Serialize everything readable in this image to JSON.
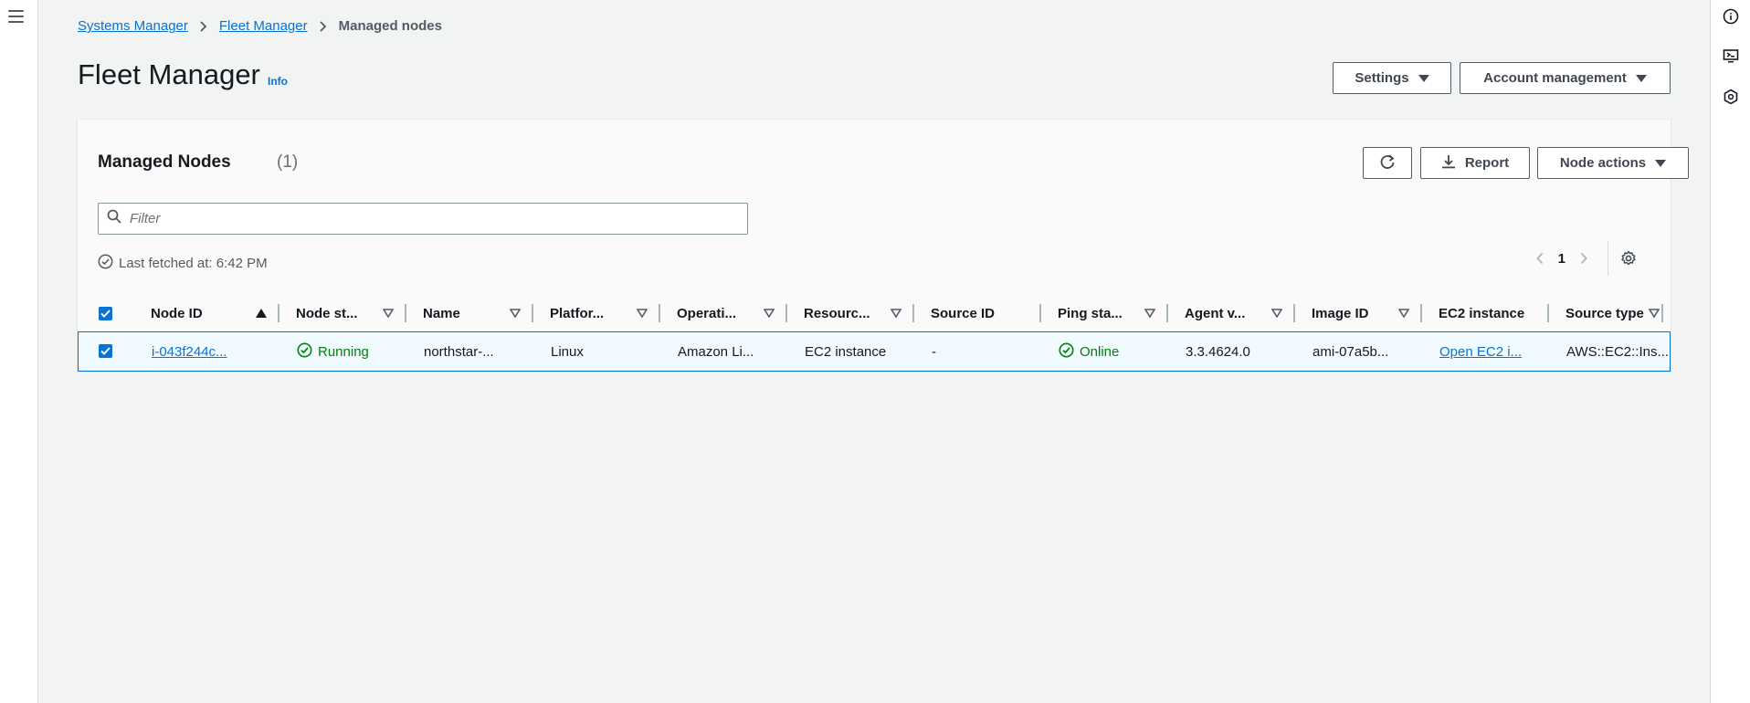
{
  "breadcrumb": {
    "items": [
      "Systems Manager",
      "Fleet Manager"
    ],
    "current": "Managed nodes"
  },
  "header": {
    "title": "Fleet Manager",
    "info": "Info",
    "settings_label": "Settings",
    "account_label": "Account management"
  },
  "panel": {
    "title": "Managed Nodes",
    "count": "(1)",
    "report_label": "Report",
    "node_actions_label": "Node actions",
    "filter_placeholder": "Filter",
    "last_fetched": "Last fetched at: 6:42 PM",
    "page": "1"
  },
  "table": {
    "columns": [
      "Node ID",
      "Node st...",
      "Name",
      "Platfor...",
      "Operati...",
      "Resourc...",
      "Source ID",
      "Ping sta...",
      "Agent v...",
      "Image ID",
      "EC2 instance",
      "Source type"
    ],
    "rows": [
      {
        "node_id": "i-043f244c...",
        "node_status": "Running",
        "name": "northstar-...",
        "platform": "Linux",
        "os": "Amazon Li...",
        "resource": "EC2 instance",
        "source_id": "-",
        "ping": "Online",
        "agent": "3.3.4624.0",
        "image_id": "ami-07a5b...",
        "ec2_instance": "Open EC2 i...",
        "source_type": "AWS::EC2::Ins..."
      }
    ]
  },
  "colors": {
    "link": "#0972d3",
    "success": "#037f0c",
    "selected_row_bg": "#f1faff",
    "page_bg": "#f2f3f3"
  },
  "icons": [
    "menu-icon",
    "info-icon",
    "cloudshell-icon",
    "feedback-icon",
    "chevron-right-icon",
    "refresh-icon",
    "download-icon",
    "search-icon",
    "check-circle-icon",
    "chevron-left-icon",
    "gear-icon",
    "sort-ascending-icon",
    "filter-triangle-icon"
  ]
}
